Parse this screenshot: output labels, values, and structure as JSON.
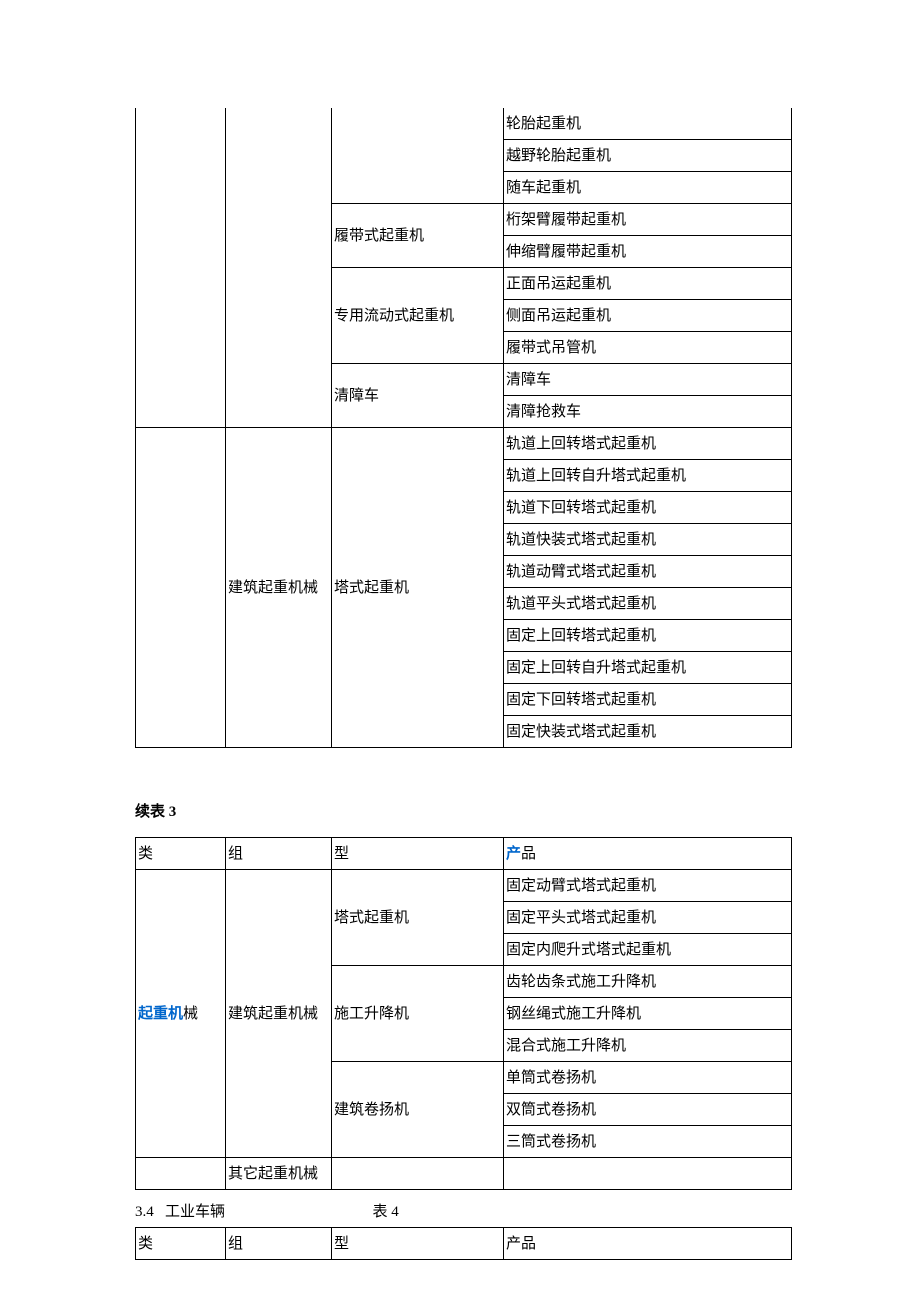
{
  "table1": {
    "col1_rows": [
      {
        "text": "轮胎起重机"
      },
      {
        "text": "越野轮胎起重机"
      },
      {
        "text": "随车起重机"
      }
    ],
    "crawler_label": "履带式起重机",
    "crawler_rows": [
      "桁架臂履带起重机",
      "伸缩臂履带起重机"
    ],
    "mobile_label": "专用流动式起重机",
    "mobile_rows": [
      "正面吊运起重机",
      "侧面吊运起重机",
      "履带式吊管机"
    ],
    "wrecker_label": "清障车",
    "wrecker_rows": [
      "清障车",
      "清障抢救车"
    ],
    "construction_label": "建筑起重机械",
    "tower_label": "塔式起重机",
    "tower_rows": [
      "轨道上回转塔式起重机",
      "轨道上回转自升塔式起重机",
      "轨道下回转塔式起重机",
      "轨道快装式塔式起重机",
      "轨道动臂式塔式起重机",
      "轨道平头式塔式起重机",
      "固定上回转塔式起重机",
      "固定上回转自升塔式起重机",
      "固定下回转塔式起重机",
      "固定快装式塔式起重机"
    ]
  },
  "caption": "续表 3",
  "table2": {
    "headers": [
      "类",
      "组",
      "型",
      "产品"
    ],
    "header_product_prefix": "产",
    "header_product_suffix": "品",
    "col0_prefix": "起重机",
    "col0_suffix": "械",
    "construction_label": "建筑起重机械",
    "tower_label": "塔式起重机",
    "tower_rows": [
      "固定动臂式塔式起重机",
      "固定平头式塔式起重机",
      "固定内爬升式塔式起重机"
    ],
    "shigong_label": "施工升降机",
    "shigong_prefix_char": "施",
    "shigong_rows": [
      "齿轮齿条式施工升降机",
      "钢丝绳式施工升降机",
      "混合式施工升降机"
    ],
    "winch_label": "建筑卷扬机",
    "winch_rows": [
      "单筒式卷扬机",
      "双筒式卷扬机",
      "三筒式卷扬机"
    ],
    "other_label": "其它起重机械"
  },
  "section_label_num": "3.4",
  "section_label_text": "工业车辆",
  "table4_label": "表 4",
  "table3": {
    "headers": [
      "类",
      "组",
      "型",
      "产品"
    ]
  }
}
